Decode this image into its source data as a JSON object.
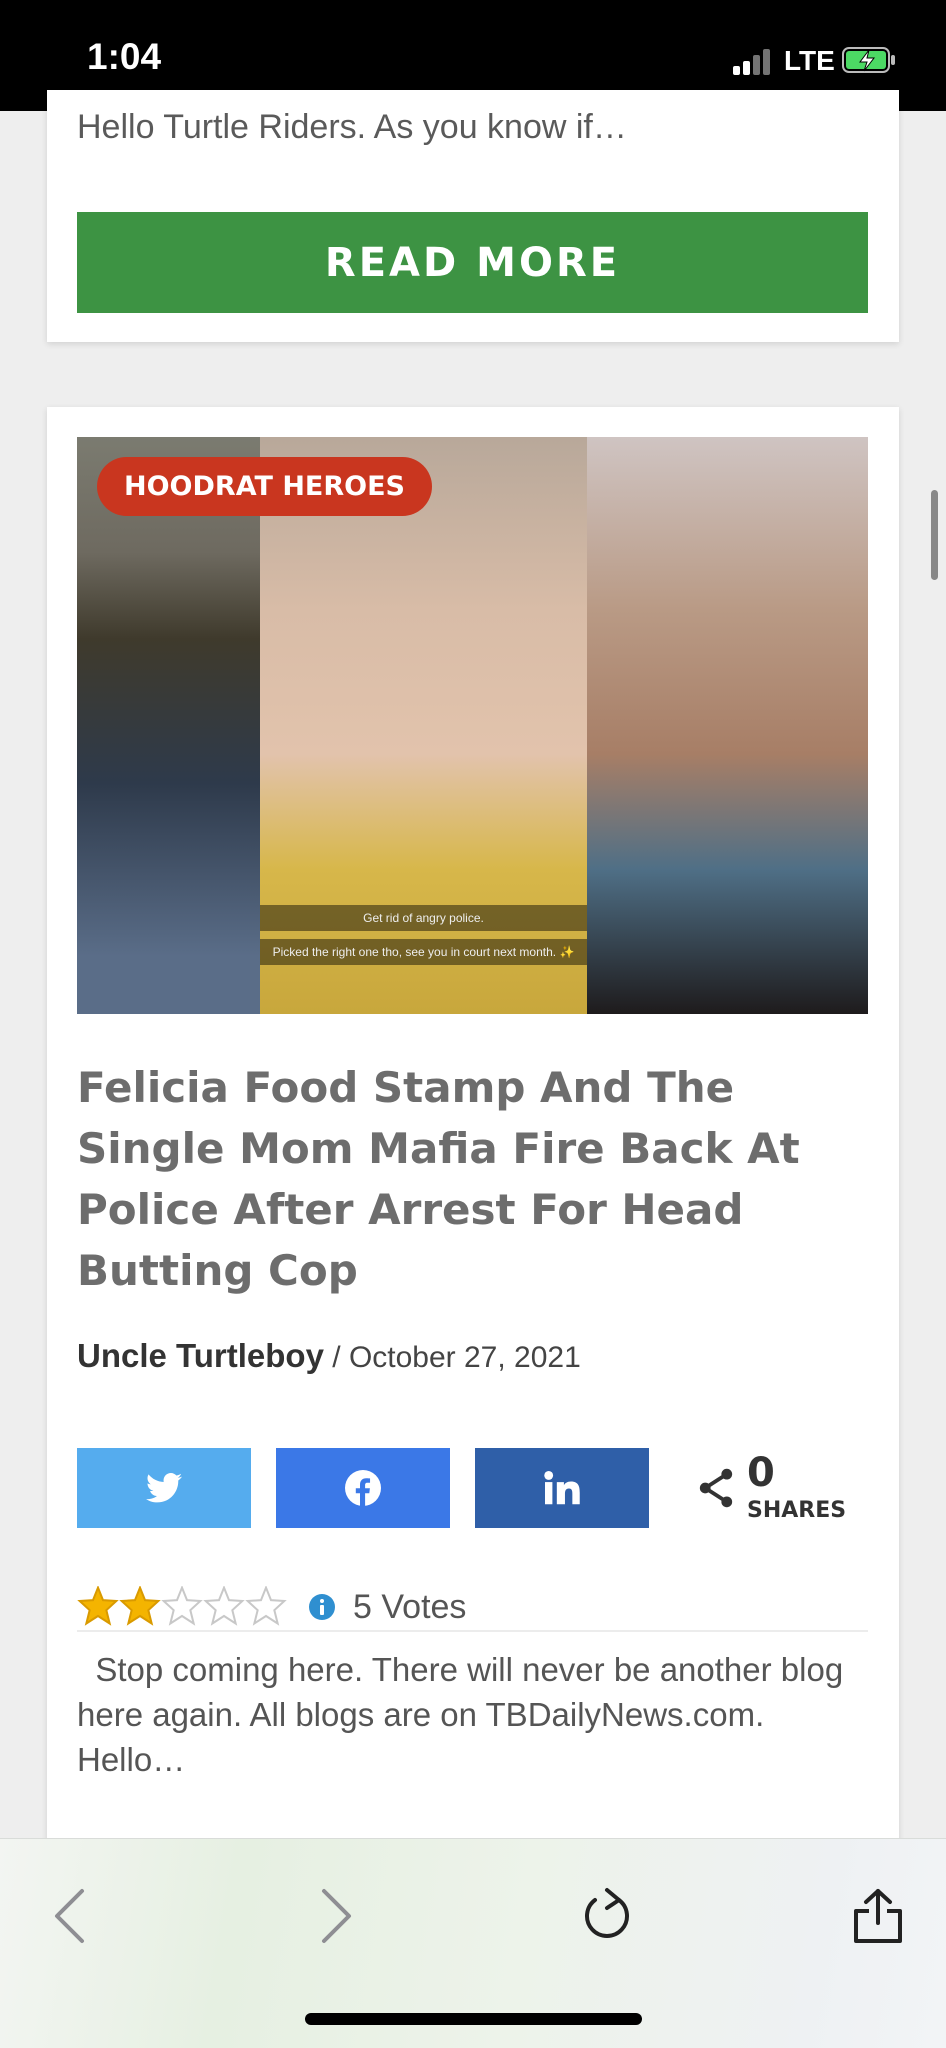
{
  "status_bar": {
    "time": "1:04",
    "network": "LTE"
  },
  "card_top": {
    "excerpt": "Hello Turtle Riders. As you know if…",
    "read_more_label": "READ MORE"
  },
  "post": {
    "category_badge": "HOODRAT HEROES",
    "image_caption_1": "Get rid of angry police.",
    "image_caption_2": "Picked the right one tho, see you in court next month. ✨",
    "title": "Felicia Food Stamp And The Single Mom Mafia Fire Back At Police After Arrest For Head Butting Cop",
    "author": "Uncle Turtleboy",
    "date_sep": " / ",
    "date": "October 27, 2021",
    "shares_count": "0",
    "shares_label": "SHARES",
    "rating_value": 2,
    "rating_max": 5,
    "votes": "5 Votes",
    "excerpt": "  Stop coming here. There will never be another blog here again. All blogs are on TBDailyNews.com.      Hello…"
  },
  "colors": {
    "read_more_green": "#3d9343",
    "badge_red": "#c9361f",
    "twitter_blue": "#55acee",
    "facebook_blue": "#3b78e7",
    "linkedin_blue": "#2f5fa8",
    "star_gold": "#f4b400"
  },
  "icons": {
    "share_buttons": [
      "twitter-icon",
      "facebook-icon",
      "linkedin-icon"
    ],
    "toolbar": [
      "back-chevron-icon",
      "forward-chevron-icon",
      "reload-icon",
      "share-icon"
    ]
  }
}
